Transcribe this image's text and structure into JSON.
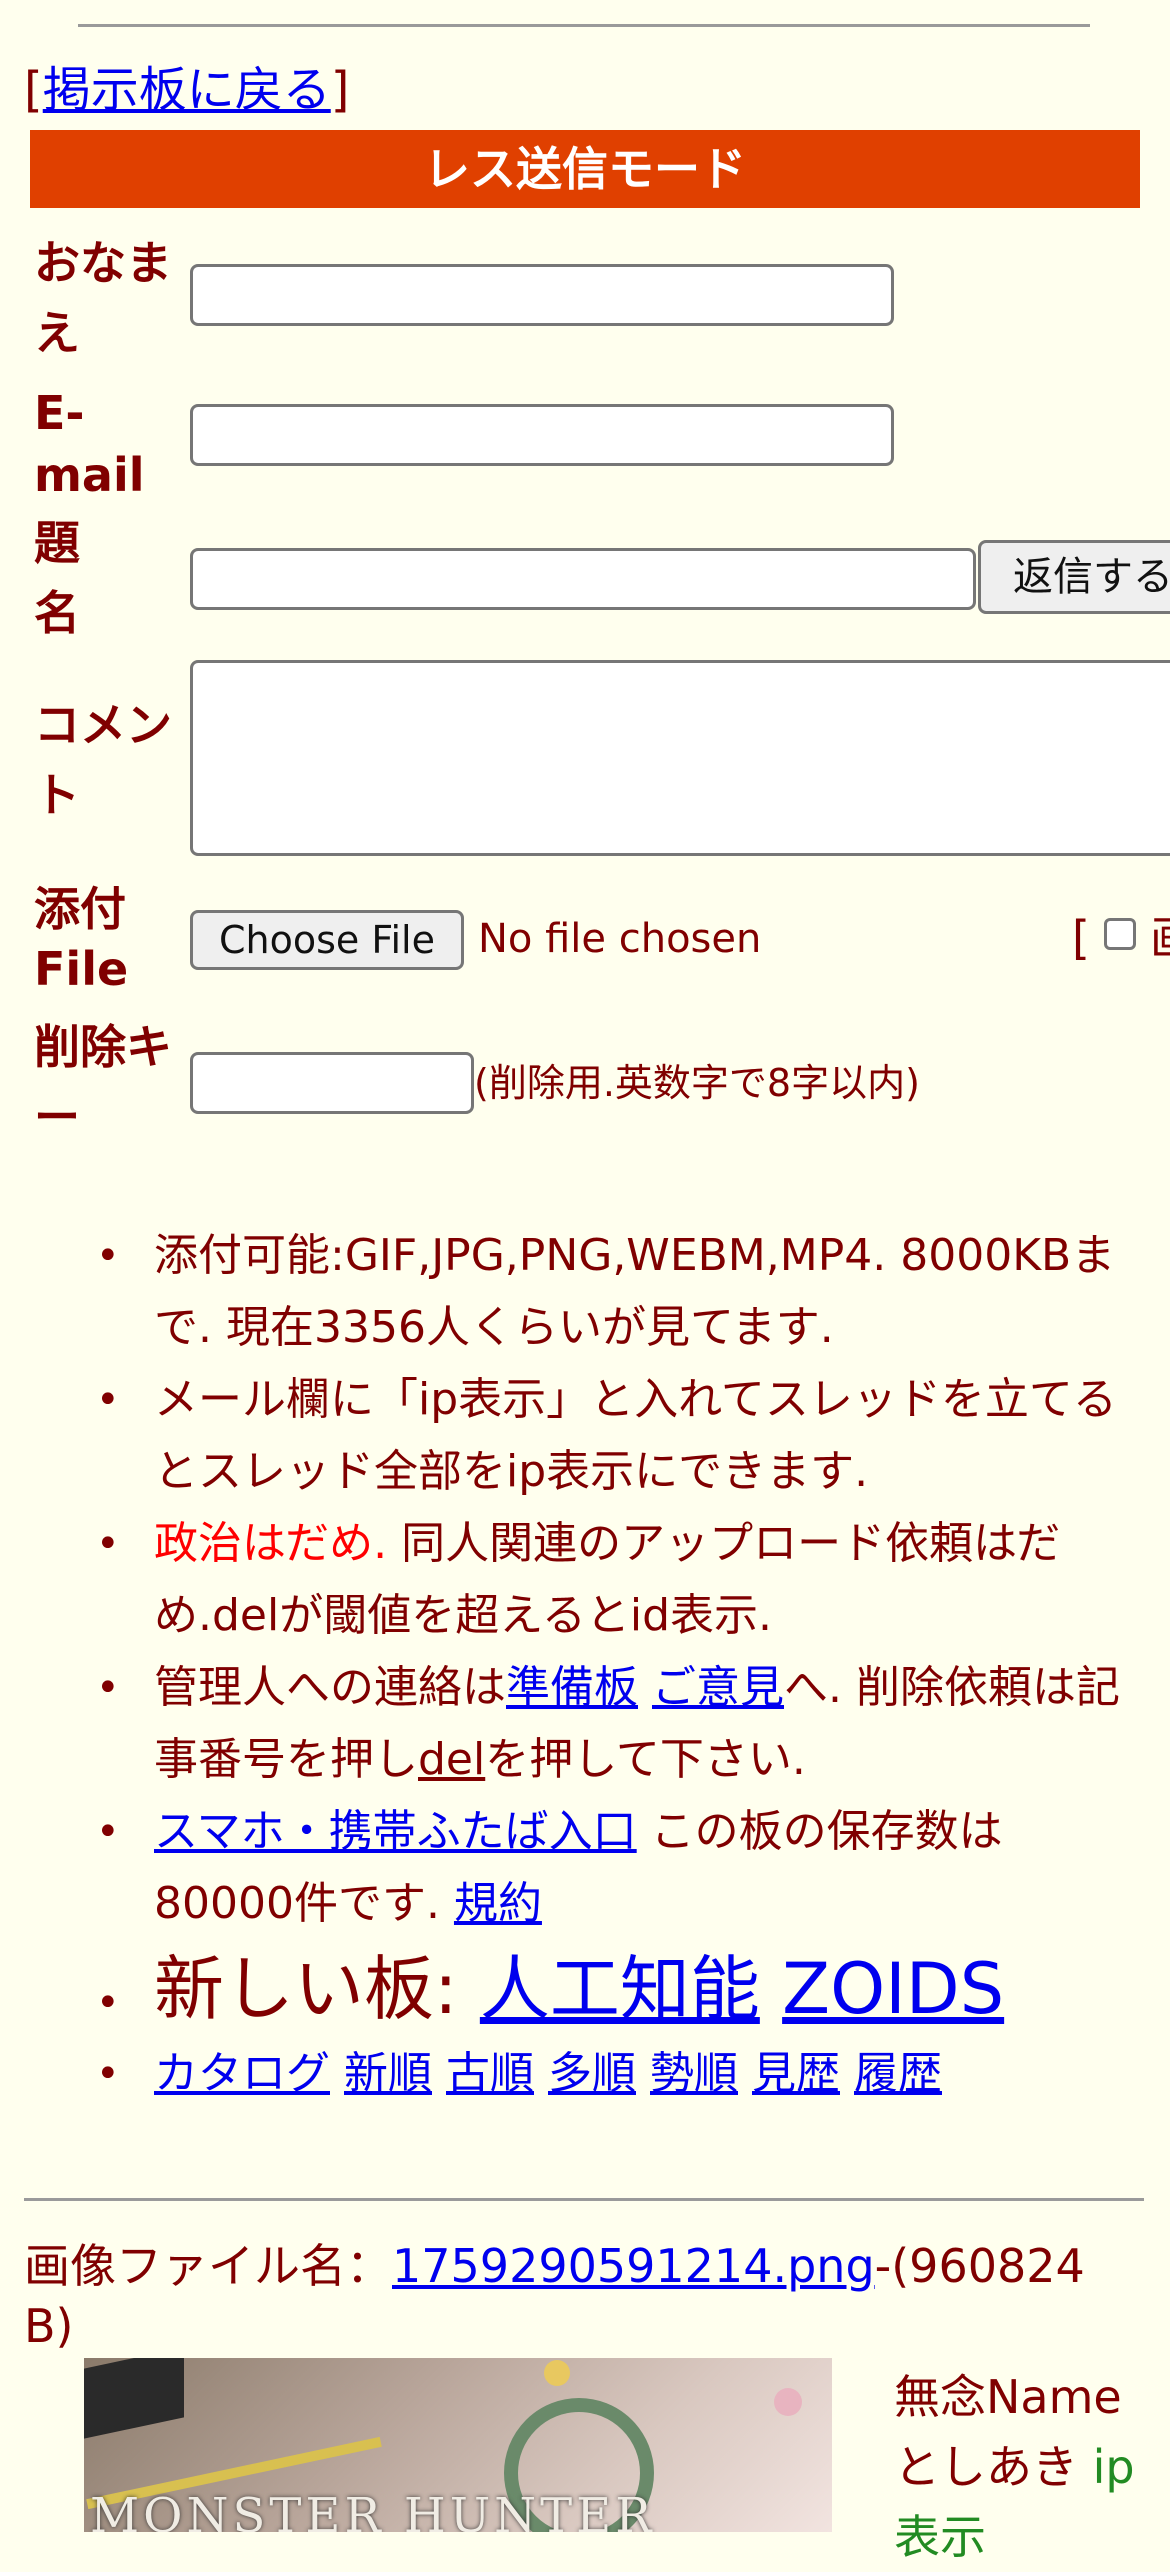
{
  "back": {
    "open": "[",
    "link": "掲示板に戻る",
    "close": "]"
  },
  "mode_title": "レス送信モード",
  "form": {
    "name_label_1": "おなま",
    "name_label_2": "え",
    "email_label_1": "E-",
    "email_label_2": "mail",
    "subject_label_1": "題",
    "subject_label_2": "名",
    "submit_label": "返信する",
    "comment_label_1": "コメン",
    "comment_label_2": "ト",
    "file_label_1": "添付",
    "file_label_2": "File",
    "choose_file": "Choose File",
    "no_file": "No file chosen",
    "image_opt_bracket": "[",
    "image_opt_cut": "画",
    "delkey_label_1": "削除キ",
    "delkey_label_2": "ー",
    "delkey_hint": "(削除用.英数字で8字以内)"
  },
  "notes": {
    "n1": "添付可能:GIF,JPG,PNG,WEBM,MP4. 8000KBまで. 現在3356人くらいが見てます.",
    "n2": "メール欄に「ip表示」と入れてスレッドを立てるとスレッド全部をip表示にできます.",
    "n3_red": "政治はだめ.",
    "n3_rest": " 同人関連のアップロード依頼はだめ.delが閾値を超えるとid表示.",
    "n4_pre": "管理人への連絡は",
    "n4_link1": "準備板",
    "n4_link2": "ご意見",
    "n4_mid": "へ. 削除依頼は記事番号を押し",
    "n4_link3": "del",
    "n4_post": "を押して下さい.",
    "n5_link": "スマホ・携帯ふたば入口",
    "n5_mid": " この板の保存数は80000件です. ",
    "n5_link2": "規約",
    "n6_pre": "新しい板: ",
    "n6_link1": "人工知能",
    "n6_link2": "ZOIDS",
    "sort_links": [
      "カタログ",
      "新順",
      "古順",
      "多順",
      "勢順",
      "見歴",
      "履歴"
    ]
  },
  "post": {
    "file_prefix": "画像ファイル名：",
    "file_name": "1759290591214.png",
    "file_size": "-(960824 B)",
    "thumb_text": "MONSTER HUNTER",
    "poster_name": "無念Name",
    "poster_name2": "としあき",
    "ip_label": "ip",
    "ip_label2": "表示"
  }
}
